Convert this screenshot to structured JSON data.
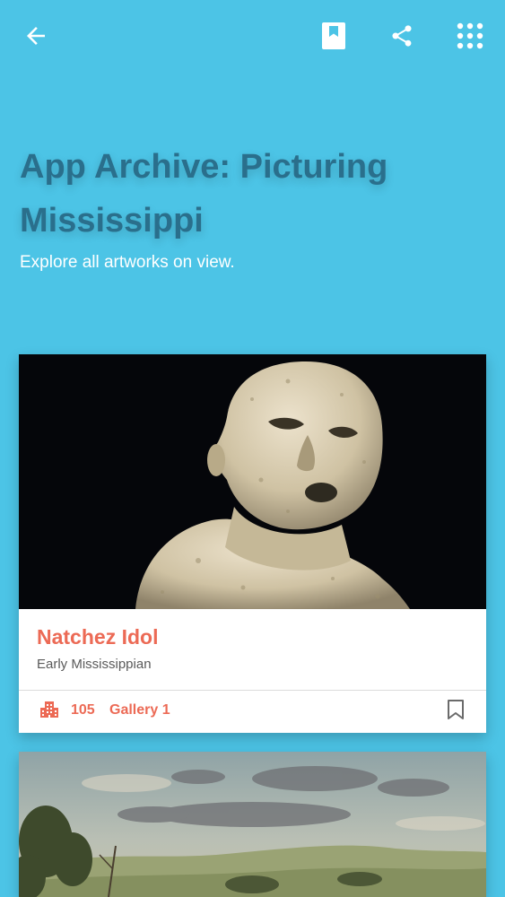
{
  "header": {
    "icons": {
      "back": "arrow-left-icon",
      "bookmark": "bookmark-icon",
      "share": "share-icon",
      "apps": "apps-grid-icon"
    }
  },
  "hero": {
    "title": "App Archive: Picturing Mississippi",
    "subtitle": "Explore all artworks on view."
  },
  "cards": [
    {
      "title": "Natchez Idol",
      "subtitle": "Early Mississippian",
      "gallery_number": "105",
      "gallery_name": "Gallery 1",
      "location_icon": "building-icon",
      "save_icon": "bookmark-outline-icon"
    }
  ],
  "colors": {
    "background": "#4cc4e6",
    "title": "#2a6f8c",
    "accent": "#ec6a55",
    "card": "#ffffff"
  }
}
